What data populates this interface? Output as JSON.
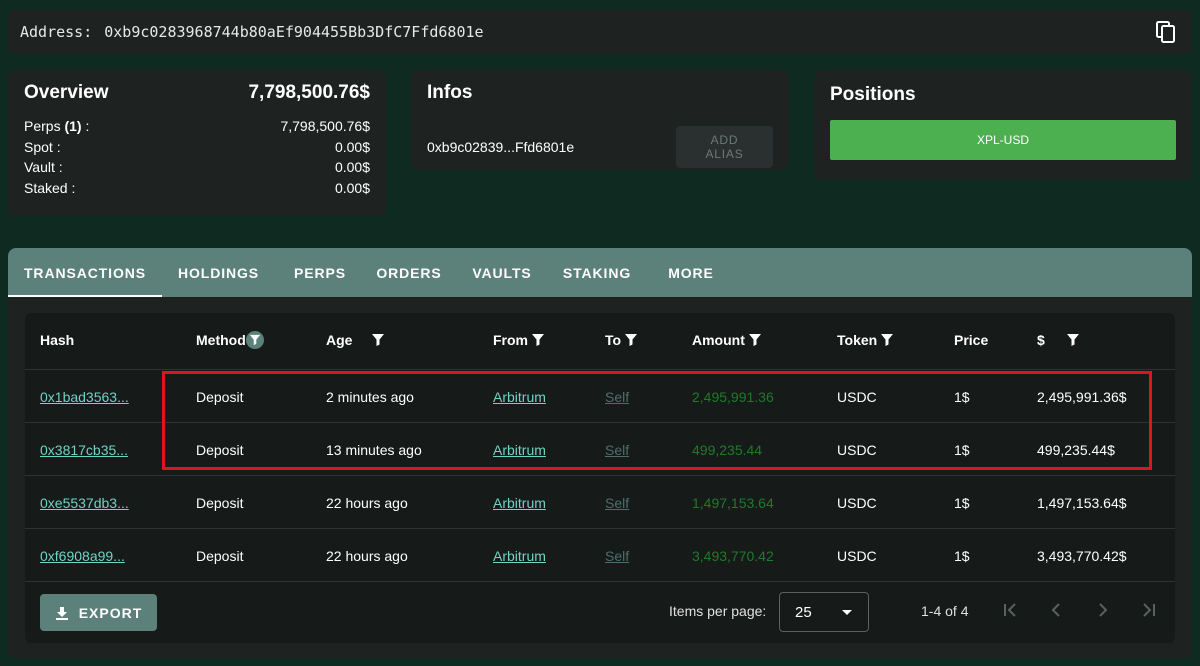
{
  "address_bar": {
    "label": "Address:",
    "address": "0xb9c0283968744b80aEf904455Bb3DfC7Ffd6801e"
  },
  "overview": {
    "title": "Overview",
    "total": "7,798,500.76$",
    "rows": [
      {
        "label": "Perps",
        "count": "(1)",
        "suffix": " :",
        "value": "7,798,500.76$"
      },
      {
        "label": "Spot :",
        "value": "0.00$"
      },
      {
        "label": "Vault :",
        "value": "0.00$"
      },
      {
        "label": "Staked :",
        "value": "0.00$"
      }
    ]
  },
  "infos": {
    "title": "Infos",
    "short_address": "0xb9c02839...Ffd6801e",
    "add_alias_label": "ADD ALIAS"
  },
  "positions": {
    "title": "Positions",
    "items": [
      "XPL-USD"
    ]
  },
  "tabs": [
    "TRANSACTIONS",
    "HOLDINGS",
    "PERPS",
    "ORDERS",
    "VAULTS",
    "STAKING",
    "MORE"
  ],
  "active_tab": "TRANSACTIONS",
  "table": {
    "headers": [
      "Hash",
      "Method",
      "Age",
      "From",
      "To",
      "Amount",
      "Token",
      "Price",
      "$"
    ],
    "rows": [
      {
        "hash": "0x1bad3563...",
        "method": "Deposit",
        "age": "2 minutes ago",
        "from": "Arbitrum",
        "to": "Self",
        "amount": "2,495,991.36",
        "token": "USDC",
        "price": "1$",
        "usd": "2,495,991.36$"
      },
      {
        "hash": "0x3817cb35...",
        "method": "Deposit",
        "age": "13 minutes ago",
        "from": "Arbitrum",
        "to": "Self",
        "amount": "499,235.44",
        "token": "USDC",
        "price": "1$",
        "usd": "499,235.44$"
      },
      {
        "hash": "0xe5537db3...",
        "method": "Deposit",
        "age": "22 hours ago",
        "from": "Arbitrum",
        "to": "Self",
        "amount": "1,497,153.64",
        "token": "USDC",
        "price": "1$",
        "usd": "1,497,153.64$"
      },
      {
        "hash": "0xf6908a99...",
        "method": "Deposit",
        "age": "22 hours ago",
        "from": "Arbitrum",
        "to": "Self",
        "amount": "3,493,770.42",
        "token": "USDC",
        "price": "1$",
        "usd": "3,493,770.42$"
      }
    ]
  },
  "footer": {
    "export_label": "EXPORT",
    "items_per_page_label": "Items per page:",
    "items_per_page_value": "25",
    "range_label": "1-4 of 4"
  },
  "colors": {
    "background": "#0e2a21",
    "card": "#1e2322",
    "tab_bar": "#5c817a",
    "link": "#6fd3c5",
    "amount_green": "#1f7a2a",
    "position_green": "#4caf50",
    "highlight_red": "#e0141e"
  }
}
